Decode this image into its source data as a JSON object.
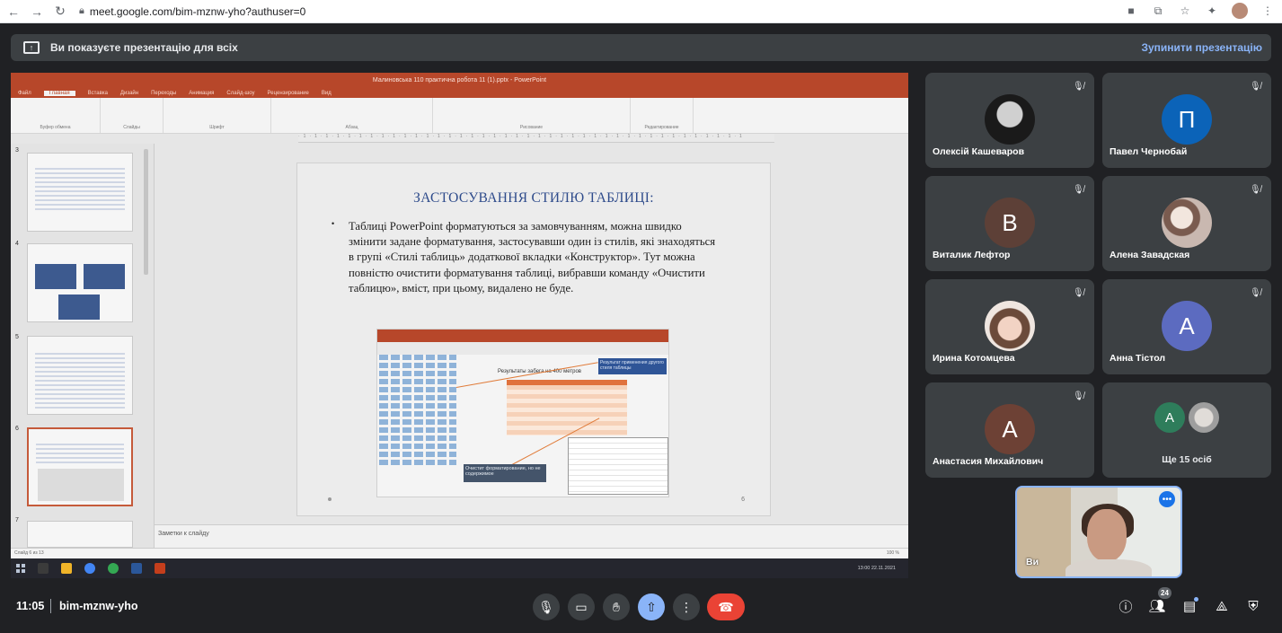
{
  "browser": {
    "url": "meet.google.com/bim-mznw-yho?authuser=0"
  },
  "banner": {
    "text": "Ви показуєте презентацію для всіх",
    "stop_label": "Зупинити презентацію"
  },
  "presentation": {
    "window_title": "Малиновська 110 практична робота 11 (1).pptx - PowerPoint",
    "tabs": [
      "Файл",
      "Главная",
      "Вставка",
      "Дизайн",
      "Переходы",
      "Анимация",
      "Слайд-шоу",
      "Рецензирование",
      "Вид"
    ],
    "ribbon_groups": [
      "Буфер обмена",
      "Слайды",
      "Шрифт",
      "Абзац",
      "Рисование",
      "Редактирование"
    ],
    "thumb_numbers": [
      "3",
      "4",
      "5",
      "6",
      "7"
    ],
    "slide": {
      "title": "ЗАСТОСУВАННЯ СТИЛЮ ТАБЛИЦІ:",
      "bullet": "•",
      "body": "Таблиці PowerPoint форматуються за замовчуванням, можна швидко змінити задане форматування, застосувавши один із стилів, які знаходяться в групі «Стилі таблиць» додаткової вкладки «Конструктор». Тут можна повністю очистити форматування таблиці, вибравши команду «Очистити таблицю», вміст, при цьому, видалено не буде.",
      "image_caption": "Результаты забега на 400 метров",
      "image_callout1": "Результат применения другого стиля таблицы",
      "image_callout2": "Очистит форматирование, но не содержимое",
      "number": "6"
    },
    "notes_placeholder": "Заметки к слайду",
    "status_left": "Слайд 6 из 13",
    "status_right": "100 %",
    "tray_time": "13:00",
    "tray_date": "22.11.2021"
  },
  "participants": [
    {
      "name": "Олексій Кашеваров",
      "initial": "",
      "avatar_color": "#2b2b2b",
      "muted": true
    },
    {
      "name": "Павел Чернобай",
      "initial": "П",
      "avatar_color": "#0b63b8",
      "muted": true
    },
    {
      "name": "Виталик Лефтор",
      "initial": "В",
      "avatar_color": "#5d4037",
      "muted": true
    },
    {
      "name": "Алена Завадская",
      "initial": "",
      "avatar_color": "#c9b8b0",
      "muted": true
    },
    {
      "name": "Ирина Котомцева",
      "initial": "",
      "avatar_color": "#e8d6cf",
      "muted": true
    },
    {
      "name": "Анна Тістол",
      "initial": "А",
      "avatar_color": "#5c6bc0",
      "muted": true
    },
    {
      "name": "Анастасия Михайлович",
      "initial": "А",
      "avatar_color": "#6d4135",
      "muted": true
    }
  ],
  "more_tile": {
    "label": "Ще 15 осіб",
    "initial": "А",
    "avatar_color": "#2e7d5b"
  },
  "self_tile": {
    "name": "Ви"
  },
  "bottom": {
    "time": "11:05",
    "code": "bim-mznw-yho",
    "people_count": "24"
  }
}
